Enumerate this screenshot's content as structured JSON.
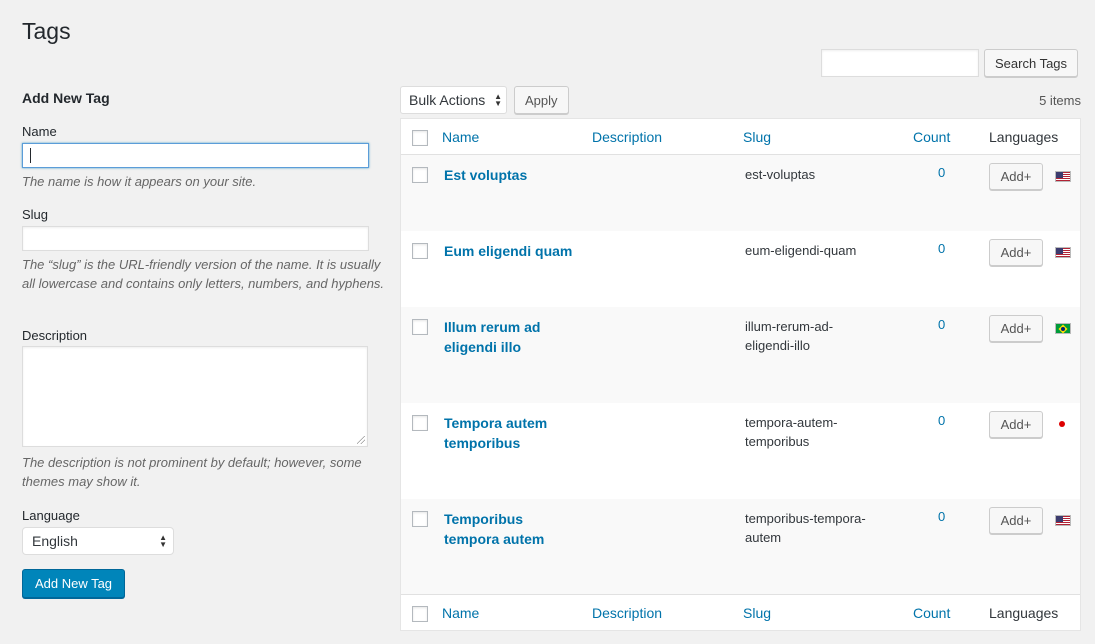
{
  "page": {
    "title": "Tags"
  },
  "search": {
    "placeholder": "",
    "button_label": "Search Tags"
  },
  "form": {
    "heading": "Add New Tag",
    "name_label": "Name",
    "name_value": "",
    "name_help": "The name is how it appears on your site.",
    "slug_label": "Slug",
    "slug_value": "",
    "slug_help": "The “slug” is the URL-friendly version of the name. It is usually all lowercase and contains only letters, numbers, and hyphens.",
    "description_label": "Description",
    "description_value": "",
    "description_help": "The description is not prominent by default; however, some themes may show it.",
    "language_label": "Language",
    "language_value": "English",
    "submit_label": "Add New Tag"
  },
  "toolbar": {
    "bulk_label": "Bulk Actions",
    "apply_label": "Apply",
    "items_count": "5 items"
  },
  "table": {
    "columns": {
      "name": "Name",
      "description": "Description",
      "slug": "Slug",
      "count": "Count",
      "languages": "Languages"
    },
    "add_label": "Add+",
    "rows": [
      {
        "name": "Est voluptas",
        "slug": "est-voluptas",
        "count": "0",
        "flag": "us-flag-icon"
      },
      {
        "name": "Eum eligendi quam",
        "slug": "eum-eligendi-quam",
        "count": "0",
        "flag": "us-flag-icon"
      },
      {
        "name": "Illum rerum ad eligendi illo",
        "slug": "illum-rerum-ad-eligendi-illo",
        "count": "0",
        "flag": "brazil-flag-icon"
      },
      {
        "name": "Tempora autem temporibus",
        "slug": "tempora-autem-temporibus",
        "count": "0",
        "flag": "red-dot-flag-icon"
      },
      {
        "name": "Temporibus tempora autem",
        "slug": "temporibus-tempora-autem",
        "count": "0",
        "flag": "us-flag-icon"
      }
    ]
  },
  "colors": {
    "link": "#0073aa",
    "primary": "#0085ba",
    "background": "#f1f1f1"
  }
}
